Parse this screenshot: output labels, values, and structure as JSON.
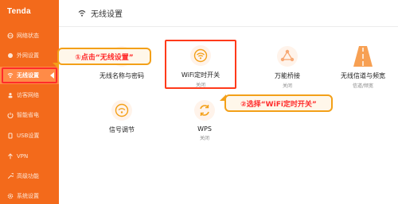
{
  "brand": "Tenda",
  "header": {
    "title": "无线设置"
  },
  "sidebar": {
    "items": [
      {
        "label": "网络状态",
        "icon": "globe-icon"
      },
      {
        "label": "外网设置",
        "icon": "network-icon"
      },
      {
        "label": "无线设置",
        "icon": "wifi-icon",
        "active": true
      },
      {
        "label": "访客网络",
        "icon": "guest-icon"
      },
      {
        "label": "智能省电",
        "icon": "power-icon"
      },
      {
        "label": "USB设置",
        "icon": "usb-icon"
      },
      {
        "label": "VPN",
        "icon": "vpn-icon"
      },
      {
        "label": "高级功能",
        "icon": "tools-icon"
      },
      {
        "label": "系统设置",
        "icon": "settings-icon"
      }
    ]
  },
  "tiles": [
    {
      "label": "无线名称与密码",
      "sub": "",
      "icon": "wifi-lock-icon"
    },
    {
      "label": "WiFi定时开关",
      "sub": "关闭",
      "icon": "wifi-timer-icon"
    },
    {
      "label": "万能桥接",
      "sub": "关闭",
      "icon": "bridge-icon"
    },
    {
      "label": "无线信道与频宽",
      "sub": "信道/频宽",
      "icon": "road-icon"
    },
    {
      "label": "信号调节",
      "sub": "",
      "icon": "signal-icon"
    },
    {
      "label": "WPS",
      "sub": "关闭",
      "icon": "wps-icon"
    }
  ],
  "callouts": {
    "step1": "①点击“无线设置”",
    "step2": "②选择“WiFi定时开关”"
  },
  "colors": {
    "sidebar": "#f36a1b",
    "accent": "#ff8b47",
    "highlight": "#ff2b2b",
    "callout_border": "#f3a018"
  }
}
